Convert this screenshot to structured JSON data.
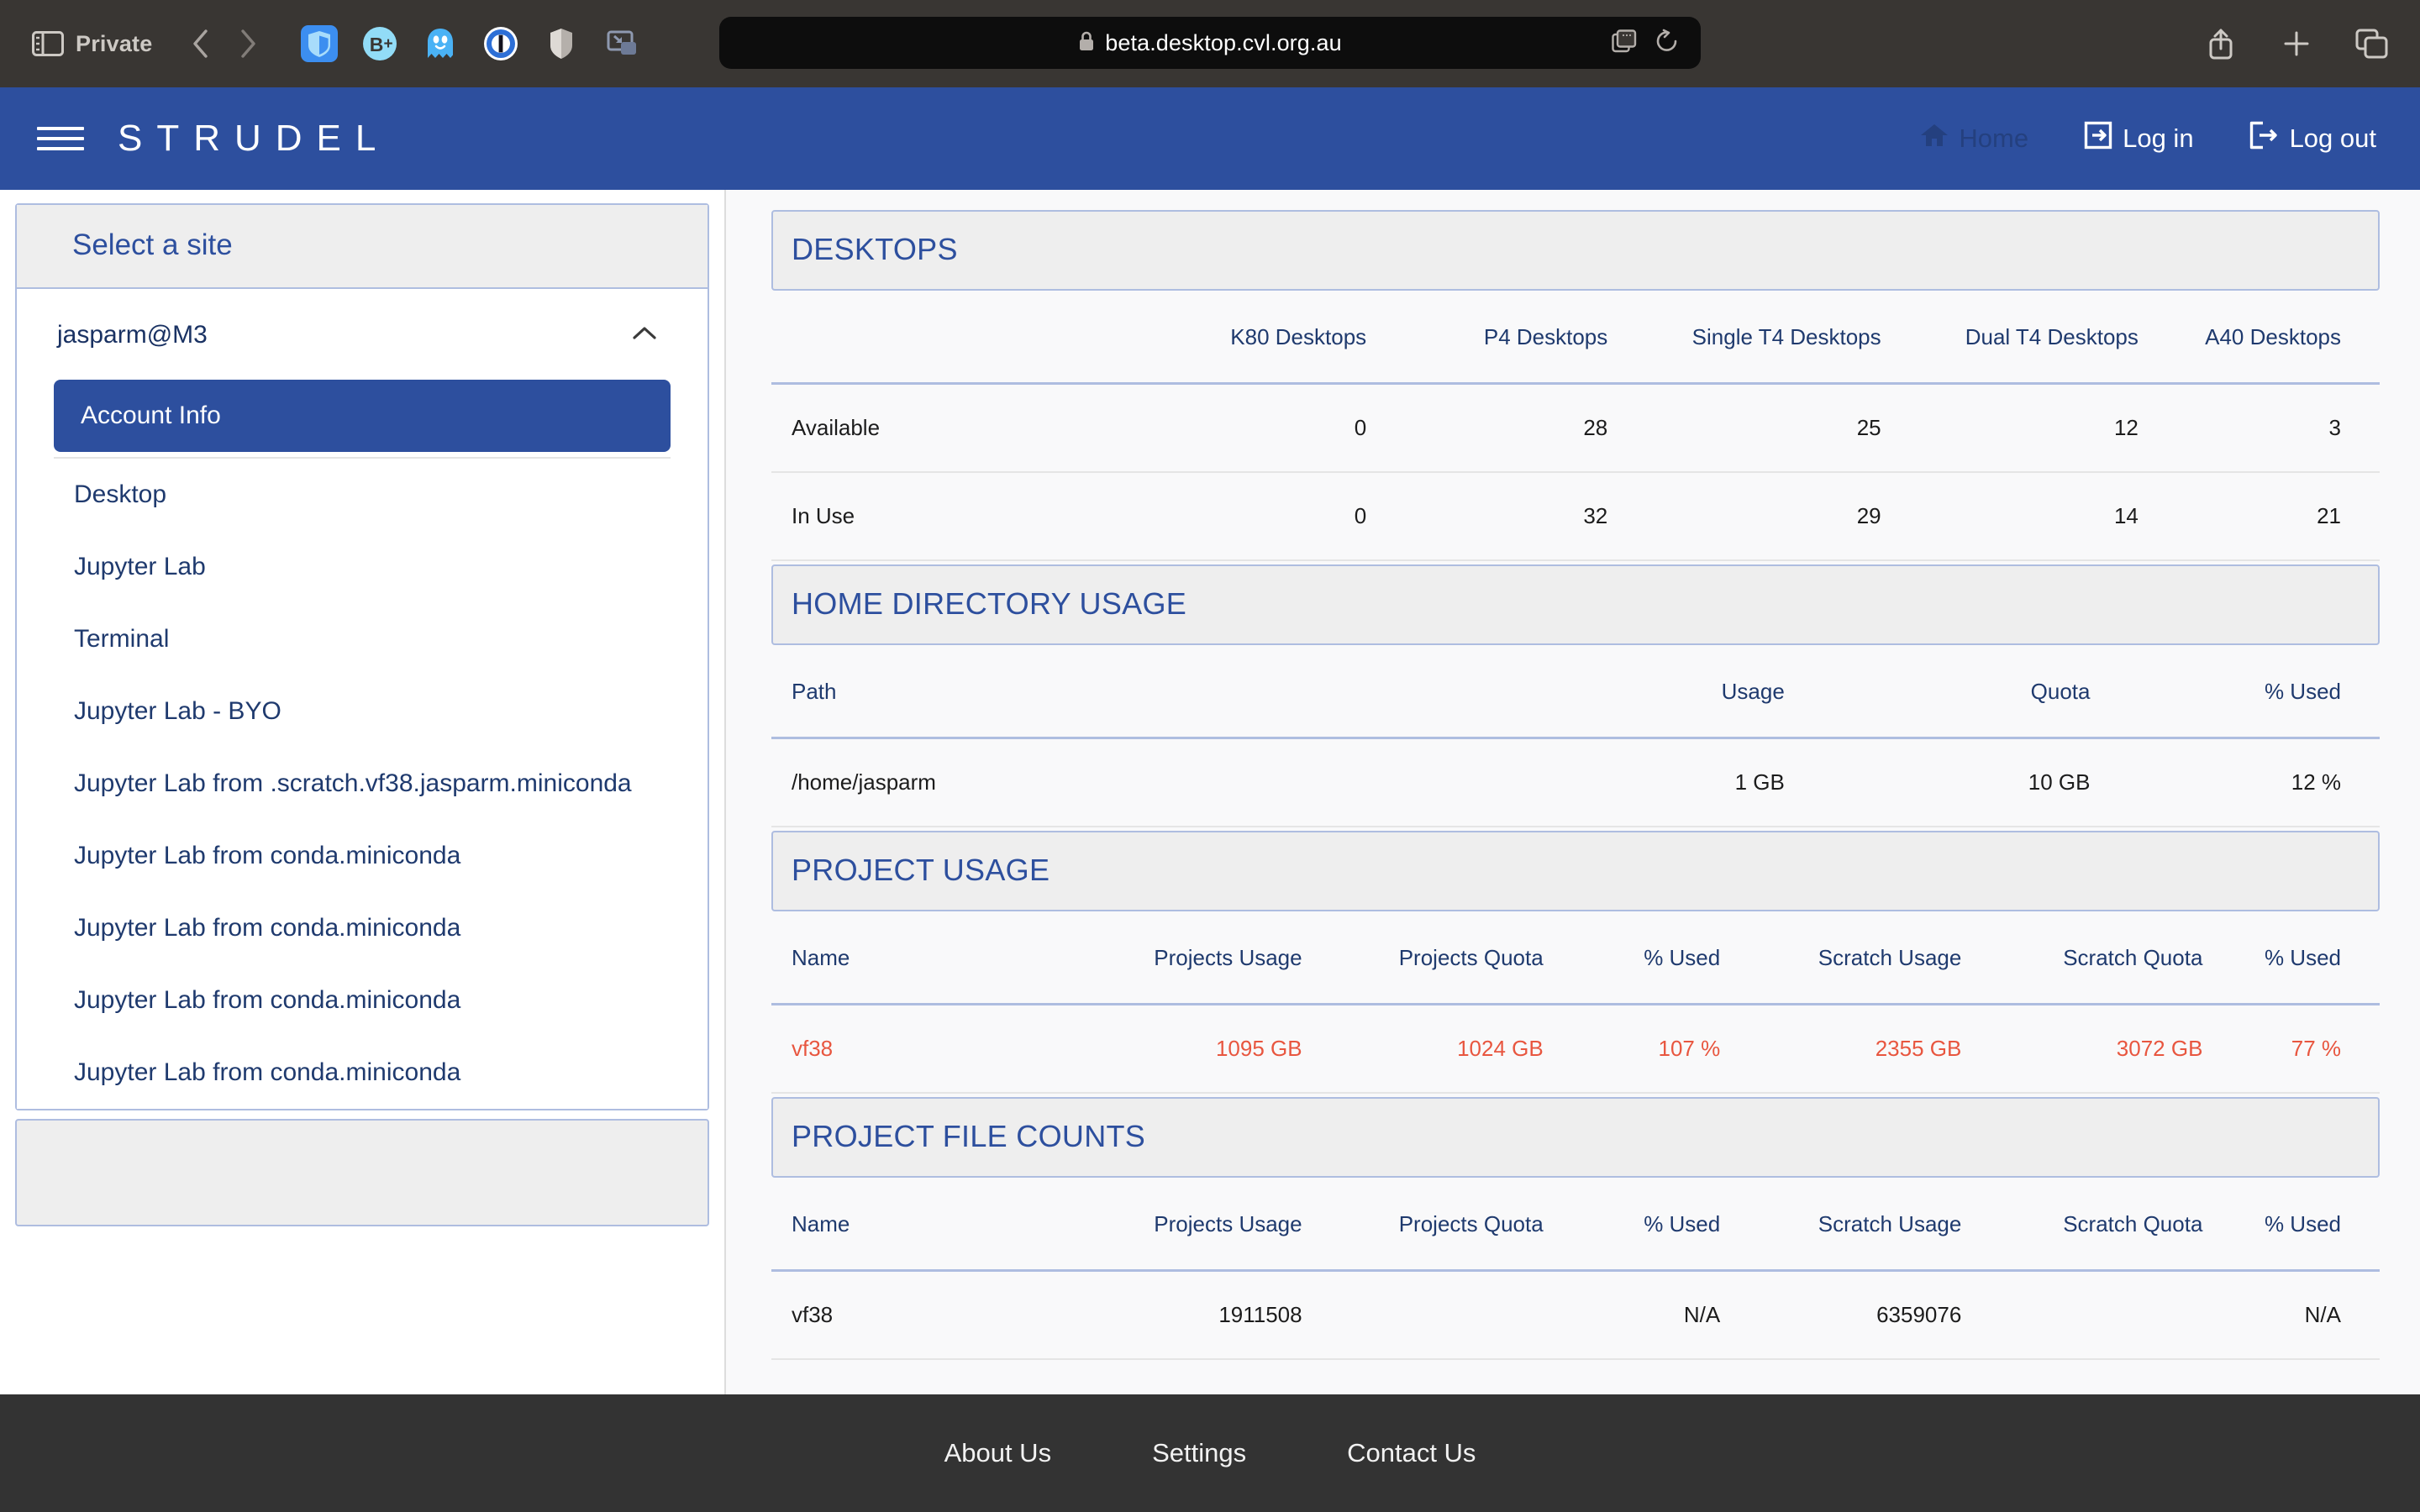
{
  "browser": {
    "private_label": "Private",
    "sidebar_toggle_icon": "sidebar-toggle-icon",
    "back_icon": "chevron-left-icon",
    "forward_icon": "chevron-right-icon",
    "extensions": [
      {
        "name": "bitwarden-shield-icon",
        "glyph": "shield"
      },
      {
        "name": "bitwarden-bplus-icon",
        "glyph": "B+"
      },
      {
        "name": "ghostery-ghost-icon",
        "glyph": "ghost"
      },
      {
        "name": "onepassword-icon",
        "glyph": "1P"
      },
      {
        "name": "privacy-shield-icon",
        "glyph": "halfshield"
      },
      {
        "name": "picture-in-picture-icon",
        "glyph": "pip"
      }
    ],
    "url": "beta.desktop.cvl.org.au",
    "lock_icon": "padlock-icon",
    "reader_icon": "reader-view-icon",
    "reload_icon": "reload-icon",
    "share_icon": "share-icon",
    "new_tab_icon": "plus-icon",
    "tab_overview_icon": "tab-overview-icon"
  },
  "header": {
    "menu_icon": "hamburger-menu-icon",
    "brand": "STRUDEL",
    "nav": [
      {
        "label": "Home",
        "icon": "home-icon",
        "state": "disabled"
      },
      {
        "label": "Log in",
        "icon": "login-icon",
        "state": "active"
      },
      {
        "label": "Log out",
        "icon": "logout-icon",
        "state": "active"
      }
    ]
  },
  "sidebar": {
    "panel_title": "Select a site",
    "group": {
      "label": "jasparm@M3",
      "collapse_icon": "chevron-up-icon",
      "expanded": true
    },
    "items": [
      {
        "label": "Account Info",
        "active": true
      },
      {
        "label": "Desktop",
        "active": false
      },
      {
        "label": "Jupyter Lab",
        "active": false
      },
      {
        "label": "Terminal",
        "active": false
      },
      {
        "label": "Jupyter Lab - BYO",
        "active": false
      },
      {
        "label": "Jupyter Lab from .scratch.vf38.jasparm.miniconda",
        "active": false
      },
      {
        "label": "Jupyter Lab from conda.miniconda",
        "active": false
      },
      {
        "label": "Jupyter Lab from conda.miniconda",
        "active": false
      },
      {
        "label": "Jupyter Lab from conda.miniconda",
        "active": false
      },
      {
        "label": "Jupyter Lab from conda.miniconda",
        "active": false
      }
    ]
  },
  "colors": {
    "brand_blue": "#2d4f9e",
    "panel_border": "#aebde0",
    "alert_red": "#e8563f",
    "chrome_bg": "#393633",
    "footer_bg": "#333333"
  },
  "cards": {
    "desktops": {
      "title": "DESKTOPS",
      "columns": [
        "",
        "K80 Desktops",
        "P4 Desktops",
        "Single T4 Desktops",
        "Dual T4 Desktops",
        "A40 Desktops"
      ],
      "rows": [
        {
          "cells": [
            "Available",
            "0",
            "28",
            "25",
            "12",
            "3"
          ],
          "alert": false
        },
        {
          "cells": [
            "In Use",
            "0",
            "32",
            "29",
            "14",
            "21"
          ],
          "alert": false
        }
      ]
    },
    "home_directory_usage": {
      "title": "HOME DIRECTORY USAGE",
      "columns": [
        "Path",
        "Usage",
        "Quota",
        "% Used"
      ],
      "rows": [
        {
          "cells": [
            "/home/jasparm",
            "1 GB",
            "10 GB",
            "12 %"
          ],
          "alert": false
        }
      ]
    },
    "project_usage": {
      "title": "PROJECT USAGE",
      "columns": [
        "Name",
        "Projects Usage",
        "Projects Quota",
        "% Used",
        "Scratch Usage",
        "Scratch Quota",
        "% Used"
      ],
      "rows": [
        {
          "cells": [
            "vf38",
            "1095 GB",
            "1024 GB",
            "107 %",
            "2355 GB",
            "3072 GB",
            "77 %"
          ],
          "alert": true
        }
      ]
    },
    "project_file_counts": {
      "title": "PROJECT FILE COUNTS",
      "columns": [
        "Name",
        "Projects Usage",
        "Projects Quota",
        "% Used",
        "Scratch Usage",
        "Scratch Quota",
        "% Used"
      ],
      "rows": [
        {
          "cells": [
            "vf38",
            "1911508",
            "",
            "N/A",
            "6359076",
            "",
            "N/A"
          ],
          "alert": false
        }
      ]
    }
  },
  "footer": {
    "links": [
      "About Us",
      "Settings",
      "Contact Us"
    ]
  }
}
